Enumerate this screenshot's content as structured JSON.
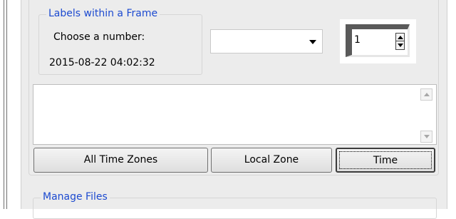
{
  "frame": {
    "legend": "Labels within a Frame",
    "label_choose": "Choose a number:",
    "timestamp": "2015-08-22 04:02:32"
  },
  "combobox": {
    "value": ""
  },
  "spinbox": {
    "value": "1"
  },
  "buttons": {
    "all_time_zones": "All Time Zones",
    "local_zone": "Local Zone",
    "time": "Time"
  },
  "manage_files": {
    "legend": "Manage Files"
  },
  "icons": [
    "combo-arrow-icon",
    "spin-up-icon",
    "spin-down-icon",
    "scroll-up-icon",
    "scroll-down-icon"
  ]
}
